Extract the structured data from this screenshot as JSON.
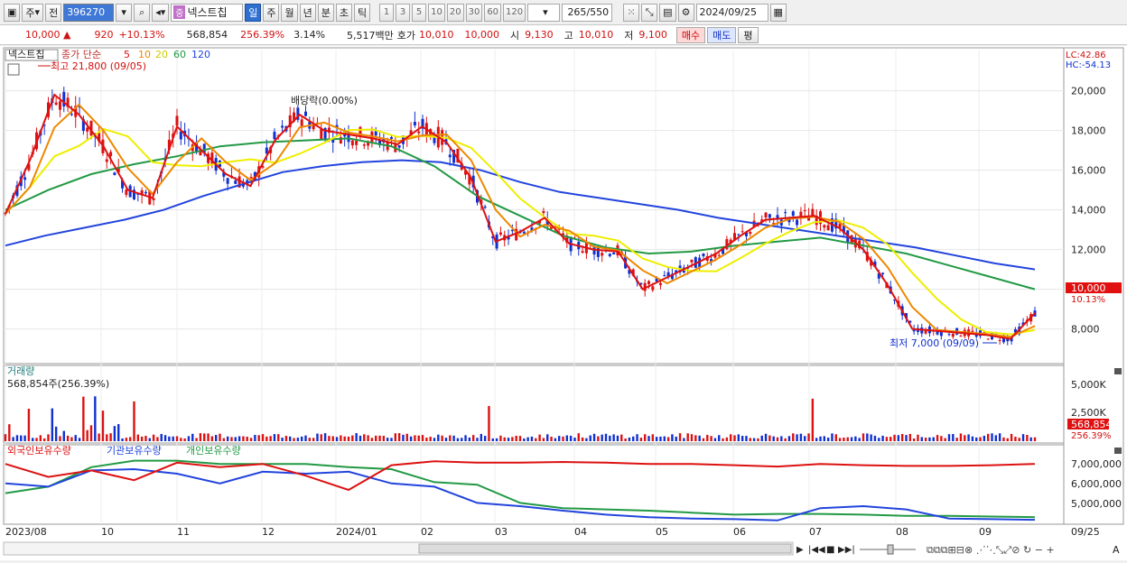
{
  "toolbar": {
    "period_label": "주",
    "prev_label": "전",
    "stock_code": "396270",
    "stock_tag": "중",
    "stock_name": "넥스트칩",
    "interval_buttons": [
      "일",
      "주",
      "월",
      "년",
      "분",
      "초",
      "틱"
    ],
    "active_interval": "일",
    "number_buttons": [
      "1",
      "3",
      "5",
      "10",
      "20",
      "30",
      "60",
      "120"
    ],
    "count_value": "265",
    "count_total": "/550",
    "date_value": "2024/09/25"
  },
  "quote": {
    "price": "10,000",
    "change": "920",
    "change_pct": "+10.13%",
    "volume": "568,854",
    "volume_ratio": "256.39%",
    "turnover": "3.14%",
    "amount": "5,517백만",
    "bid_label": "호가",
    "bid": "10,010",
    "ask": "10,000",
    "open_label": "시",
    "open": "9,130",
    "high_label": "고",
    "high": "10,010",
    "low_label": "저",
    "low": "9,100",
    "buy_btn": "매수",
    "sell_btn": "매도",
    "eval_btn": "평"
  },
  "price_panel": {
    "stock_label": "넥스트칩",
    "ma_prefix": "종가 단순",
    "ma_periods": [
      "5",
      "10",
      "20",
      "60",
      "120"
    ],
    "ma_colors": [
      "#dd1111",
      "#ee8800",
      "#eeee00",
      "#229944",
      "#2244dd"
    ],
    "high_note": "최고 21,800 (09/05)",
    "low_note": "최저 7,000 (09/09)",
    "dividend_note": "배당락(0.00%)",
    "lc": "LC:42.86",
    "hc": "HC:-54.13",
    "last_price": "10,000",
    "last_pct": "10.13%",
    "y_ticks": [
      "20,000",
      "18,000",
      "16,000",
      "14,000",
      "12,000",
      "10,000",
      "8,000"
    ]
  },
  "volume_panel": {
    "title": "거래량",
    "value_note": "568,854주(256.39%)",
    "y_ticks": [
      "5,000K",
      "2,500K"
    ],
    "last_value": "568,854",
    "last_pct": "256.39%"
  },
  "holdings_panel": {
    "series": [
      "외국인보유수량",
      "기관보유수량",
      "개인보유수량"
    ],
    "colors": [
      "#dd1111",
      "#2244dd",
      "#229944"
    ],
    "y_ticks": [
      "7,000,000",
      "6,000,000",
      "5,000,000"
    ]
  },
  "x_axis": {
    "labels": [
      "2023/08",
      "10",
      "11",
      "12",
      "2024/01",
      "02",
      "03",
      "04",
      "05",
      "06",
      "07",
      "08",
      "09"
    ],
    "right_label": "09/25"
  },
  "chart_data": {
    "type": "line",
    "title": "넥스트칩",
    "price_ylim": [
      6800,
      21800
    ],
    "series": [
      {
        "name": "5",
        "values": [
          13800,
          16500,
          19800,
          18800,
          17200,
          15000,
          14600,
          18200,
          17000,
          15800,
          15200,
          17500,
          18800,
          18000,
          17800,
          17600,
          17300,
          18200,
          17400,
          15600,
          12400,
          12900,
          13600,
          12300,
          12000,
          11900,
          10000,
          10600,
          11200,
          11800,
          12700,
          13500,
          13600,
          13700,
          13100,
          12000,
          10200,
          8000,
          7900,
          7800,
          7700,
          7500,
          8800
        ]
      },
      {
        "name": "120",
        "values": [
          12200,
          12700,
          13100,
          13500,
          14000,
          14700,
          15300,
          15900,
          16200,
          16400,
          16500,
          16400,
          16000,
          15400,
          14900,
          14600,
          14300,
          14000,
          13600,
          13300,
          13000,
          12700,
          12400,
          12100,
          11700,
          11300,
          11000
        ]
      },
      {
        "name": "60",
        "values": [
          14000,
          15000,
          15800,
          16300,
          16700,
          17200,
          17400,
          17500,
          17600,
          17200,
          16200,
          14700,
          13700,
          12700,
          12100,
          11800,
          11900,
          12200,
          12400,
          12600,
          12200,
          11800,
          11200,
          10600,
          10000
        ]
      }
    ],
    "x": [
      "2023/08",
      "10",
      "11",
      "12",
      "2024/01",
      "02",
      "03",
      "04",
      "05",
      "06",
      "07",
      "08",
      "09"
    ],
    "high": 21800,
    "low": 7000,
    "last": 10000
  }
}
